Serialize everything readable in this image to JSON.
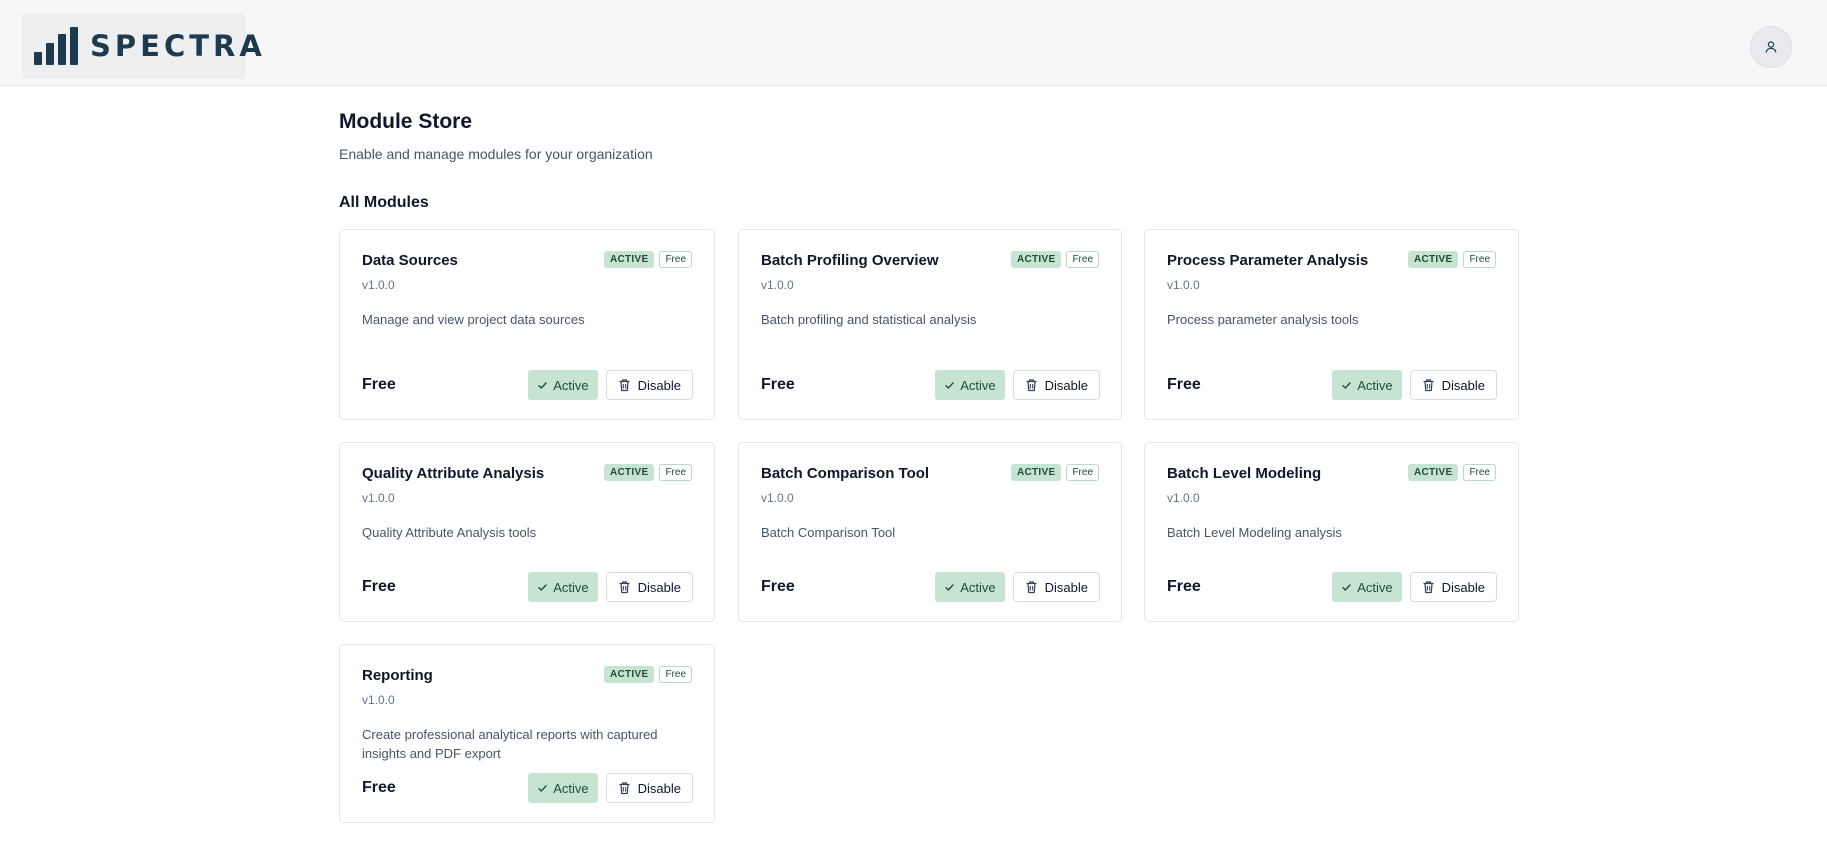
{
  "header": {
    "logo_text": "SPECTRA",
    "user_icon": "user-icon"
  },
  "page": {
    "title": "Module Store",
    "subtitle": "Enable and manage modules for your organization",
    "section_title": "All Modules"
  },
  "colors": {
    "accent_green_bg": "#c7e4d3",
    "accent_green_text": "#1f4d35",
    "brand_navy": "#1e3a4f"
  },
  "modules": [
    {
      "name": "Data Sources",
      "version": "v1.0.0",
      "description": "Manage and view project data sources",
      "status_badge": "ACTIVE",
      "price_badge": "Free",
      "price": "Free",
      "active_label": "Active",
      "disable_label": "Disable"
    },
    {
      "name": "Batch Profiling Overview",
      "version": "v1.0.0",
      "description": "Batch profiling and statistical analysis",
      "status_badge": "ACTIVE",
      "price_badge": "Free",
      "price": "Free",
      "active_label": "Active",
      "disable_label": "Disable"
    },
    {
      "name": "Process Parameter Analysis",
      "version": "v1.0.0",
      "description": "Process parameter analysis tools",
      "status_badge": "ACTIVE",
      "price_badge": "Free",
      "price": "Free",
      "active_label": "Active",
      "disable_label": "Disable"
    },
    {
      "name": "Quality Attribute Analysis",
      "version": "v1.0.0",
      "description": "Quality Attribute Analysis tools",
      "status_badge": "ACTIVE",
      "price_badge": "Free",
      "price": "Free",
      "active_label": "Active",
      "disable_label": "Disable"
    },
    {
      "name": "Batch Comparison Tool",
      "version": "v1.0.0",
      "description": "Batch Comparison Tool",
      "status_badge": "ACTIVE",
      "price_badge": "Free",
      "price": "Free",
      "active_label": "Active",
      "disable_label": "Disable"
    },
    {
      "name": "Batch Level Modeling",
      "version": "v1.0.0",
      "description": "Batch Level Modeling analysis",
      "status_badge": "ACTIVE",
      "price_badge": "Free",
      "price": "Free",
      "active_label": "Active",
      "disable_label": "Disable"
    },
    {
      "name": "Reporting",
      "version": "v1.0.0",
      "description": "Create professional analytical reports with captured insights and PDF export",
      "status_badge": "ACTIVE",
      "price_badge": "Free",
      "price": "Free",
      "active_label": "Active",
      "disable_label": "Disable"
    }
  ]
}
